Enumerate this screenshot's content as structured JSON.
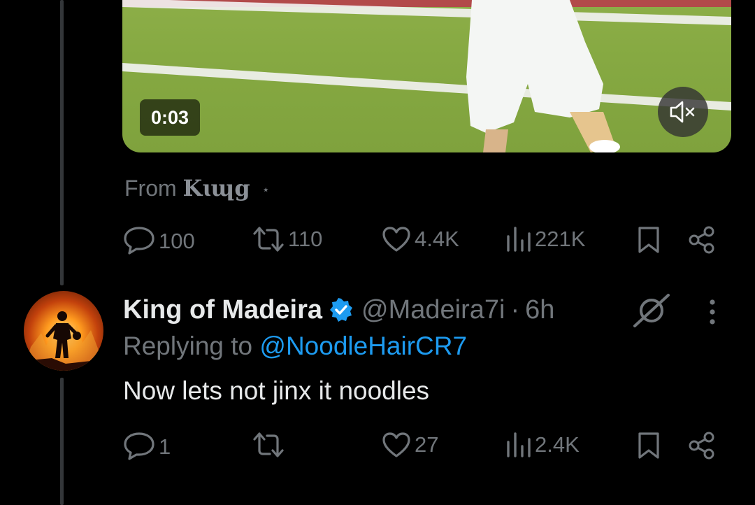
{
  "video": {
    "duration": "0:03",
    "mute_icon": "speaker-muted-icon"
  },
  "source_line": {
    "prefix": "From",
    "brand": "Kɩɰg",
    "star": "⋆"
  },
  "parent_actions": {
    "replies": "100",
    "reposts": "110",
    "likes": "4.4K",
    "views": "221K"
  },
  "reply": {
    "display_name": "King of Madeira",
    "verified": true,
    "handle": "@Madeira7i",
    "separator": "·",
    "time": "6h",
    "replying_prefix": "Replying to",
    "replying_to": "@NoodleHairCR7",
    "text": "Now lets not jinx it noodles",
    "actions": {
      "replies": "1",
      "reposts": "",
      "likes": "27",
      "views": "2.4K"
    }
  },
  "colors": {
    "accent": "#1d9bf0",
    "muted": "#71767b",
    "text": "#e7e9ea",
    "background": "#000000"
  }
}
